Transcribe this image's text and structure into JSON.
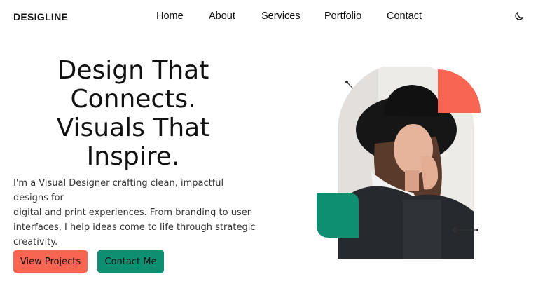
{
  "brand": "DESIGLINE",
  "nav": {
    "items": [
      "Home",
      "About",
      "Services",
      "Portfolio",
      "Contact"
    ],
    "theme_toggle_icon": "moon-icon"
  },
  "hero": {
    "title_lines": [
      "Design That",
      "Connects.",
      "Visuals That",
      "Inspire."
    ],
    "description_lines": [
      "I'm a Visual Designer crafting clean, impactful designs for",
      "digital and print experiences. From branding to user",
      "interfaces, I help ideas come to life through strategic",
      "creativity."
    ],
    "primary_button": "View Projects",
    "secondary_button": "Contact Me"
  },
  "colors": {
    "coral": "#f86553",
    "teal": "#0f8f72"
  }
}
